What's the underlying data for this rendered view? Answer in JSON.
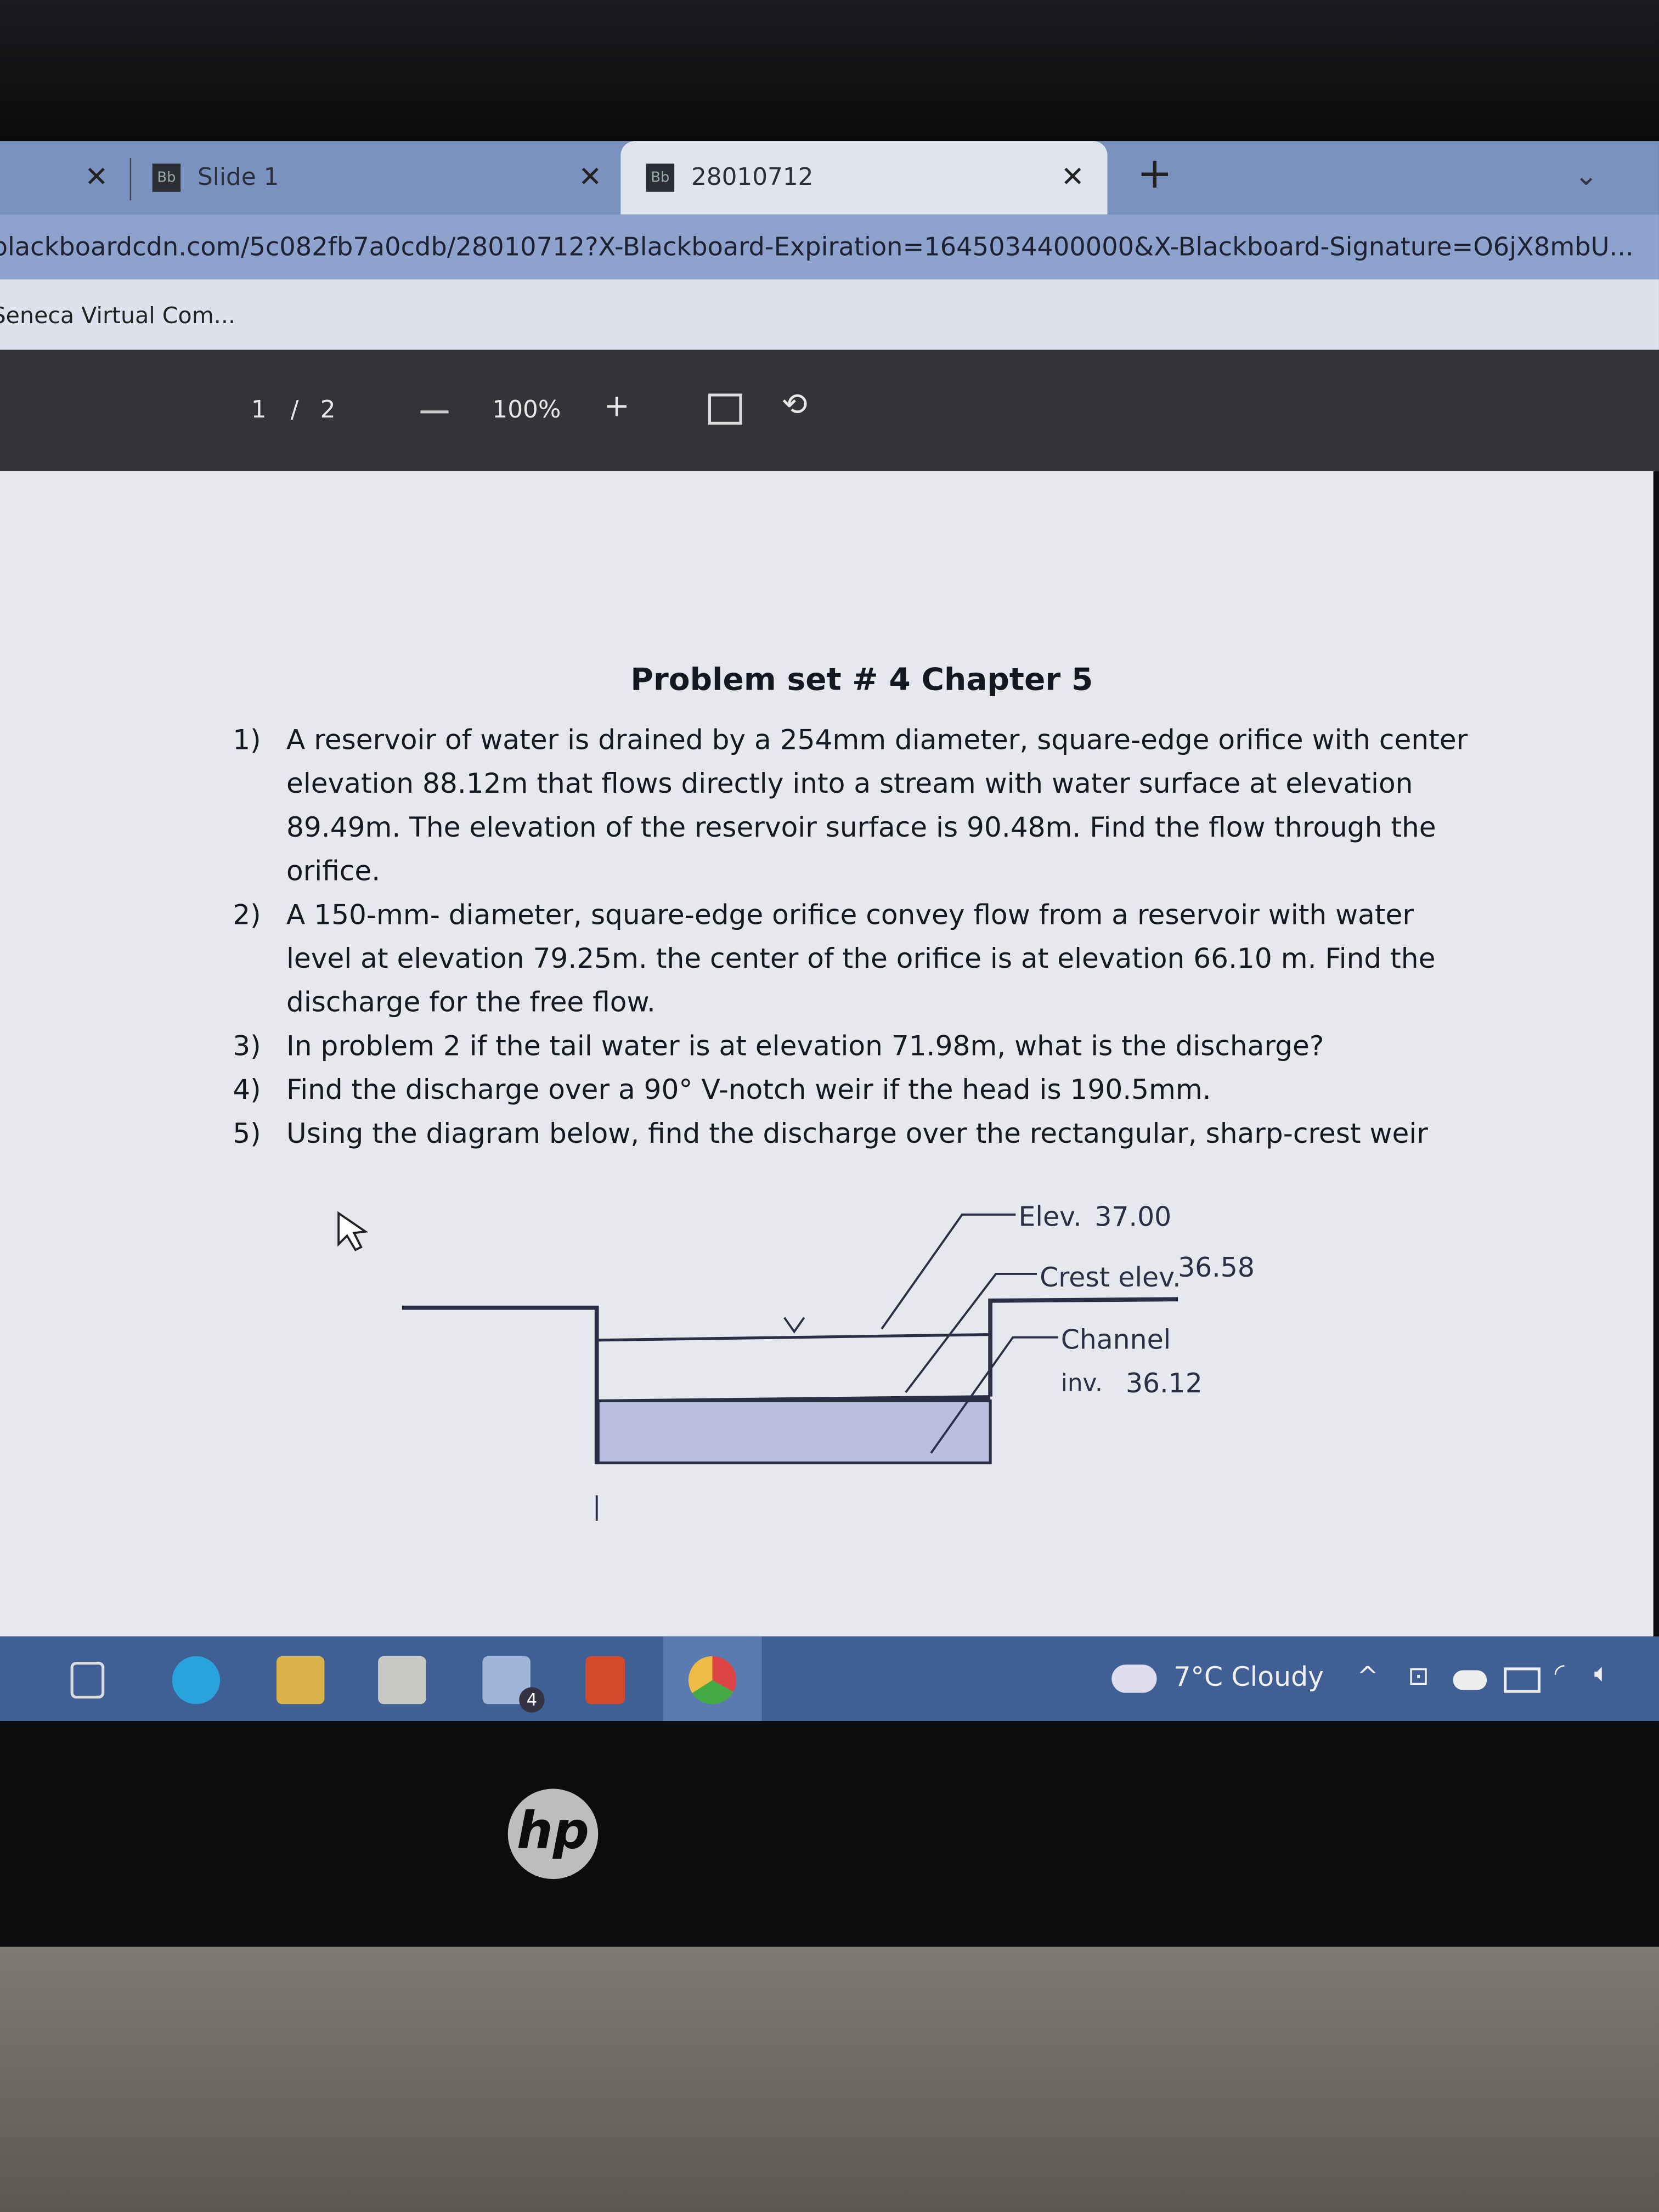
{
  "browser": {
    "tabs": [
      {
        "label": "Slide 1",
        "favicon": "Bb",
        "active": false
      },
      {
        "label": "28010712",
        "favicon": "Bb",
        "active": true
      }
    ],
    "url": "blackboardcdn.com/5c082fb7a0cdb/28010712?X-Blackboard-Expiration=1645034400000&X-Blackboard-Signature=O6jX8mbU...",
    "bookmark": "Seneca Virtual Com..."
  },
  "pdf_toolbar": {
    "page_current": "1",
    "page_sep": "/",
    "page_total": "2",
    "zoom": "100%"
  },
  "document": {
    "title": "Problem set # 4 Chapter 5",
    "problems": [
      {
        "num": "1)",
        "text": "A reservoir of water is drained by a 254mm diameter, square-edge orifice with center elevation 88.12m that flows directly into a stream with water surface at elevation 89.49m. The elevation of the reservoir surface is 90.48m. Find the flow through the orifice."
      },
      {
        "num": "2)",
        "text": "A 150-mm- diameter, square-edge orifice convey flow from a reservoir with water level at elevation 79.25m. the center of the orifice is at elevation 66.10 m. Find the discharge for the free flow."
      },
      {
        "num": "3)",
        "text": "In problem 2 if the tail water is at elevation 71.98m, what is the discharge?"
      },
      {
        "num": "4)",
        "text": "Find the discharge over a 90° V-notch weir if the head is 190.5mm."
      },
      {
        "num": "5)",
        "text": "Using the diagram below, find the discharge over the rectangular, sharp-crest weir"
      }
    ],
    "diagram": {
      "elev_label": "Elev.",
      "elev_value": "37.00",
      "crest_label": "Crest elev.",
      "crest_value": "36.58",
      "channel_label": "Channel",
      "inv_label": "inv.",
      "inv_value": "36.12"
    }
  },
  "taskbar": {
    "weather": "7°C  Cloudy",
    "mail_badge": "4"
  },
  "laptop": {
    "brand": "hp"
  }
}
